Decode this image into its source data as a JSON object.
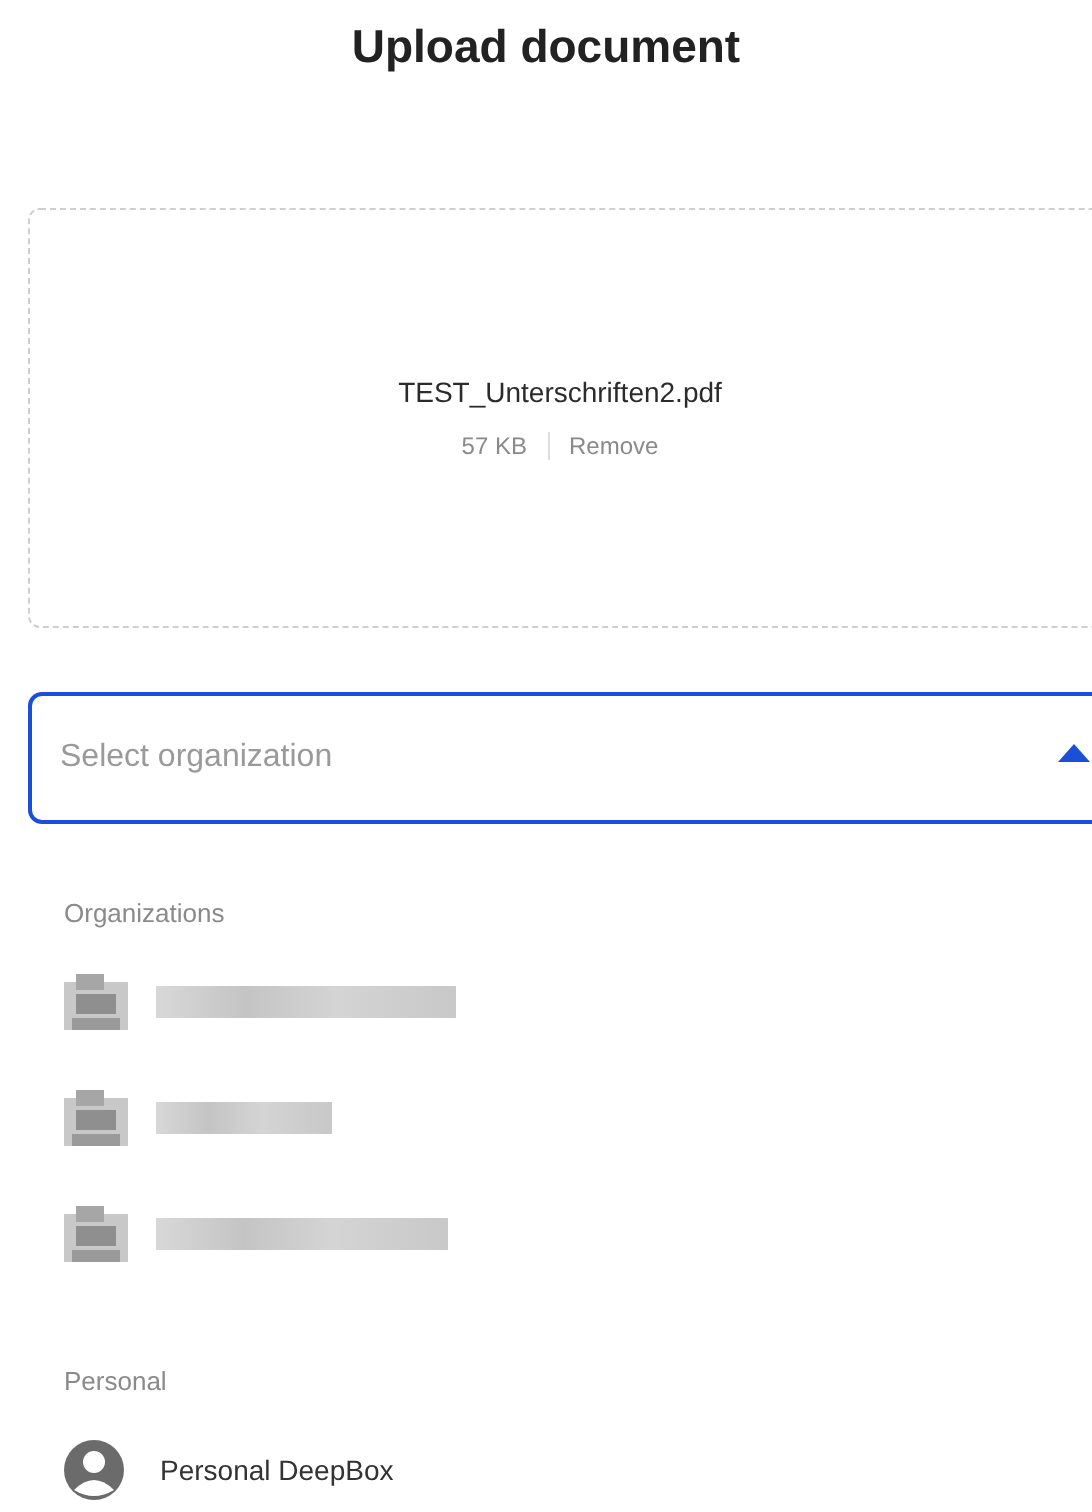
{
  "title": "Upload document",
  "file": {
    "name": "TEST_Unterschriften2.pdf",
    "size": "57 KB",
    "remove": "Remove"
  },
  "select": {
    "placeholder": "Select organization",
    "expanded": true
  },
  "groups": [
    {
      "heading": "Organizations",
      "items": [
        {
          "kind": "blurred"
        },
        {
          "kind": "blurred"
        },
        {
          "kind": "blurred"
        }
      ]
    },
    {
      "heading": "Personal",
      "items": [
        {
          "kind": "personal",
          "label": "Personal DeepBox"
        }
      ]
    }
  ]
}
